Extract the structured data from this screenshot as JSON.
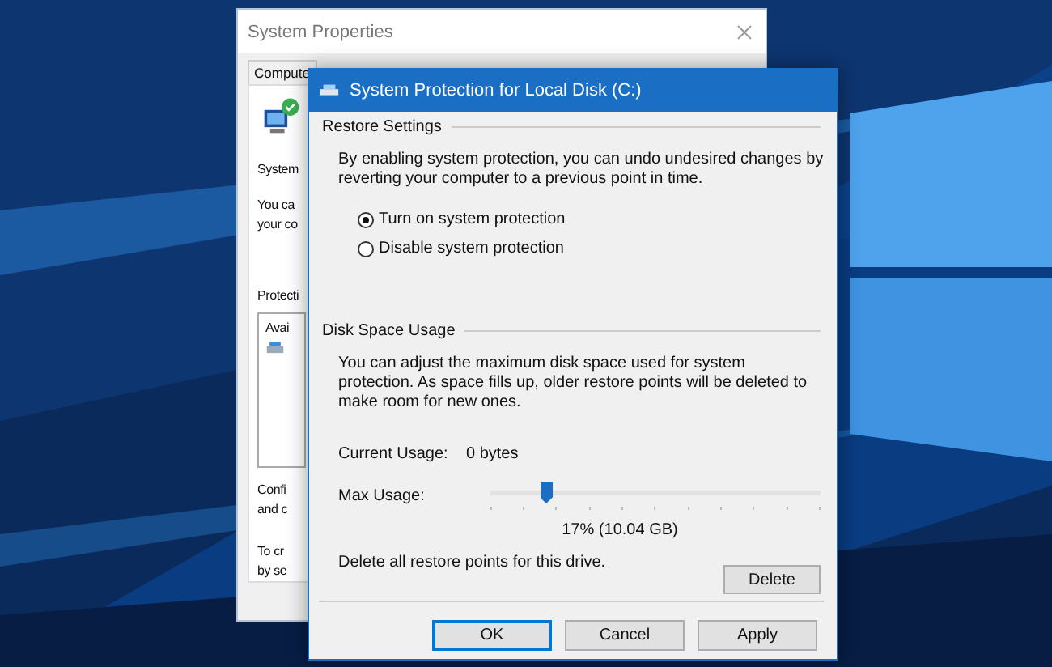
{
  "back_window": {
    "title": "System Properties",
    "tabs": [
      "Compute"
    ],
    "heading_fragment": "System",
    "intro_fragments": [
      "You ca",
      "your co"
    ],
    "protection_fragment": "Protecti",
    "list_fragment": "Avai",
    "configure_fragments": [
      "Confi",
      "and c"
    ],
    "create_fragments": [
      "To cr",
      "by se"
    ]
  },
  "dialog": {
    "title": "System Protection for Local Disk (C:)",
    "restore_settings": {
      "heading": "Restore Settings",
      "description": "By enabling system protection, you can undo undesired changes by reverting your computer to a previous point in time.",
      "options": [
        {
          "label": "Turn on system protection",
          "selected": true
        },
        {
          "label": "Disable system protection",
          "selected": false
        }
      ]
    },
    "disk_space": {
      "heading": "Disk Space Usage",
      "description": "You can adjust the maximum disk space used for system protection. As space fills up, older restore points will be deleted to make room for new ones.",
      "current_usage_label": "Current Usage:",
      "current_usage_value": "0 bytes",
      "max_usage_label": "Max Usage:",
      "max_usage": {
        "level": 0.17
      },
      "max_usage_reading": "17% (10.04 GB)",
      "delete_text": "Delete all restore points for this drive.",
      "delete_button": "Delete"
    },
    "buttons": [
      {
        "label": "OK",
        "default": true
      },
      {
        "label": "Cancel",
        "default": false
      },
      {
        "label": "Apply",
        "default": false
      }
    ]
  }
}
